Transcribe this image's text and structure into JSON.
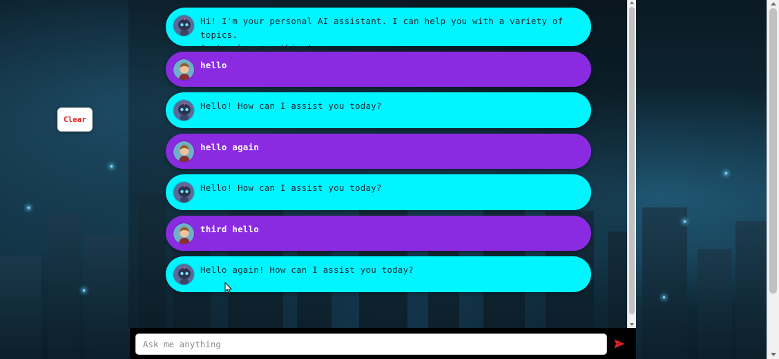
{
  "clear_button": {
    "label": "Clear"
  },
  "messages": [
    {
      "role": "bot",
      "text": "Hi! I'm your personal AI assistant. I can help you with a variety of topics.\nJust ask me anything!"
    },
    {
      "role": "user",
      "text": "hello"
    },
    {
      "role": "bot",
      "text": "Hello! How can I assist you today?"
    },
    {
      "role": "user",
      "text": "hello again"
    },
    {
      "role": "bot",
      "text": "Hello! How can I assist you today?"
    },
    {
      "role": "user",
      "text": "third hello"
    },
    {
      "role": "bot",
      "text": "Hello again! How can I assist you today?"
    }
  ],
  "input": {
    "placeholder": "Ask me anything",
    "value": ""
  },
  "icons": {
    "send": "send-icon",
    "bot_avatar": "robot-avatar-icon",
    "user_avatar": "user-avatar-icon"
  },
  "colors": {
    "bot_bubble": "#00f5ff",
    "user_bubble": "#8a2be2",
    "clear_text": "#e02020",
    "send_icon": "#e0242b"
  }
}
